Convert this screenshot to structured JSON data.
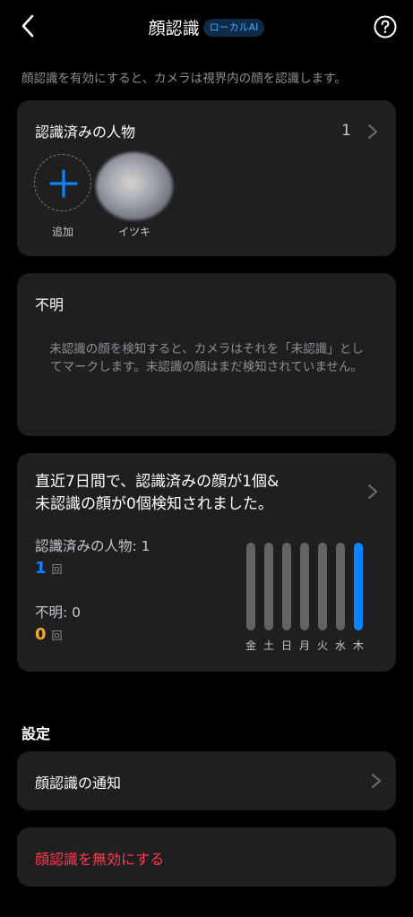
{
  "header": {
    "title": "顔認識",
    "badge": "ローカルAI",
    "back_icon": "chevron-left-icon",
    "help_icon": "question-circle-icon"
  },
  "intro": "顔認識を有効にすると、カメラは視界内の顔を認識します。",
  "recognized": {
    "title": "認識済みの人物",
    "count": "1",
    "add_label": "追加",
    "people": [
      {
        "name": "イツキ"
      }
    ]
  },
  "unknown": {
    "title": "不明",
    "message": "未認識の顔を検知すると、カメラはそれを「未認識」としてマークします。未認識の顔はまだ検知されていません。"
  },
  "stats": {
    "summary_line1": "直近7日間で、認識済みの顔が1個&",
    "summary_line2": "未認識の顔が0個検知されました。",
    "recognized_label": "認識済みの人物: 1",
    "recognized_value": "1",
    "recognized_unit": "回",
    "unknown_label": "不明: 0",
    "unknown_value": "0",
    "unknown_unit": "回"
  },
  "chart_data": {
    "type": "bar",
    "categories": [
      "金",
      "土",
      "日",
      "月",
      "火",
      "水",
      "木"
    ],
    "values": [
      0,
      0,
      0,
      0,
      0,
      0,
      1
    ],
    "highlight_index": 6,
    "colors": {
      "highlight": "#0a84ff",
      "default": "#636366"
    }
  },
  "settings": {
    "section_title": "設定",
    "notify_label": "顔認識の通知",
    "disable_label": "顔認識を無効にする"
  },
  "colors": {
    "accent": "#0a84ff",
    "danger": "#ff3b4e",
    "warning": "#f5a623",
    "card_bg": "#1f1f22"
  }
}
